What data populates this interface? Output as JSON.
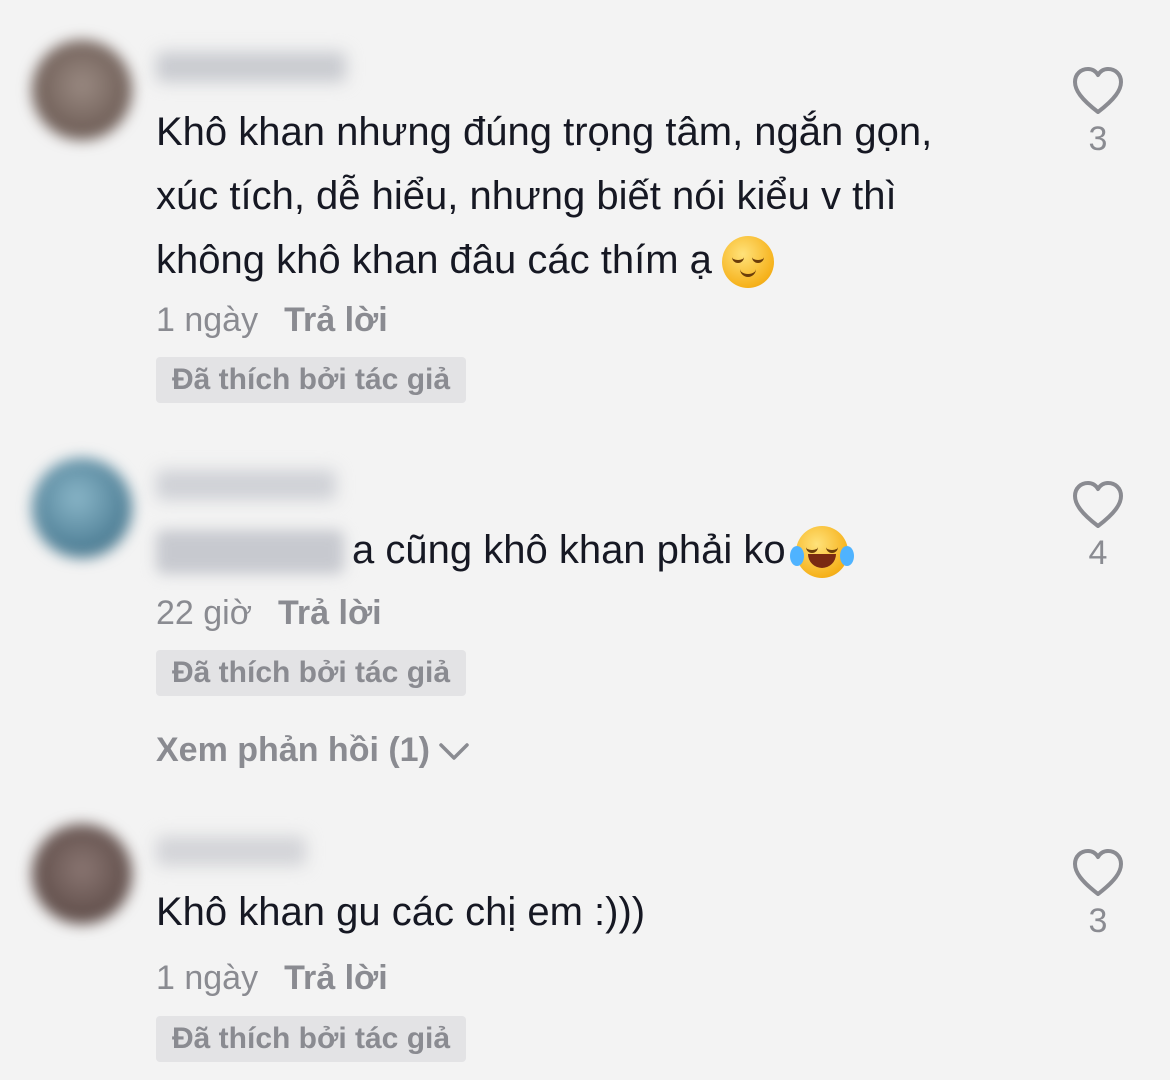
{
  "comments": [
    {
      "text": "Khô khan nhưng đúng trọng tâm, ngắn gọn,\nxúc tích, dễ hiểu, nhưng biết nói kiểu v thì\nkhông khô khan đâu các thím ạ",
      "emoji": "relieved-face-emoji",
      "time": "1 ngày",
      "reply_label": "Trả lời",
      "liked_badge": "Đã thích bởi tác giả",
      "likes": "3",
      "avatar_color": "#7a6a63"
    },
    {
      "text": "a cũng khô khan phải ko",
      "emoji": "tears-of-joy-emoji",
      "time": "22 giờ",
      "reply_label": "Trả lời",
      "liked_badge": "Đã thích bởi tác giả",
      "likes": "4",
      "view_replies": "Xem phản hồi (1)",
      "avatar_color": "#5a8aa0"
    },
    {
      "text": "Khô khan gu các chị em :)))",
      "time": "1 ngày",
      "reply_label": "Trả lời",
      "liked_badge": "Đã thích bởi tác giả",
      "likes": "3",
      "avatar_color": "#6e5a55"
    }
  ],
  "colors": {
    "background": "#f3f3f3",
    "text_primary": "#161823",
    "text_secondary": "#8a8b91",
    "badge_bg": "#e3e3e5"
  },
  "icons": {
    "like": "heart-outline-icon",
    "expand": "chevron-down-icon"
  }
}
